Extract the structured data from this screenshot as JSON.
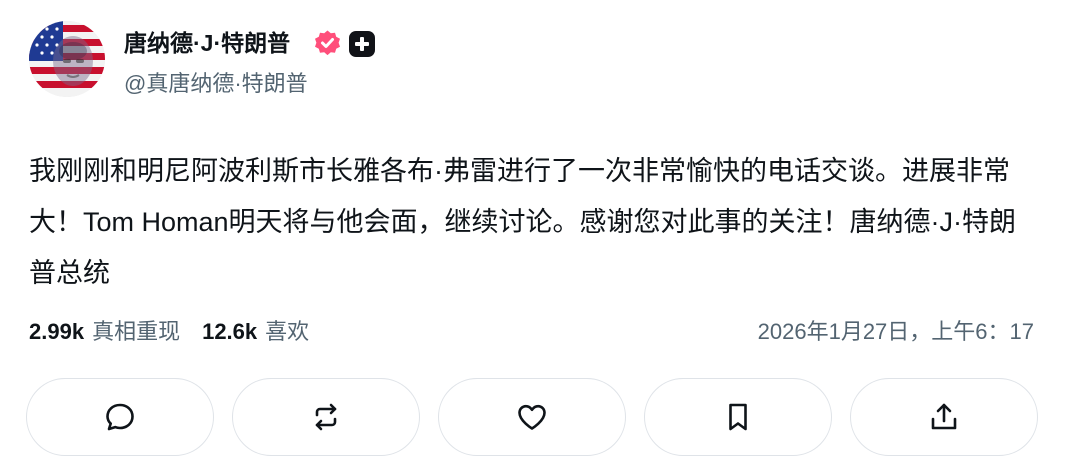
{
  "author": {
    "display_name": "唐纳德·J·特朗普",
    "handle": "@真唐纳德·特朗普",
    "verified_badge_color": "#ff4f7b",
    "subscriber_badge_color": "#111318"
  },
  "post": {
    "text": "我刚刚和明尼阿波利斯市长雅各布·弗雷进行了一次非常愉快的电话交谈。进展非常大！Tom Homan明天将与他会面，继续讨论。感谢您对此事的关注！唐纳德·J·特朗普总统",
    "timestamp": "2026年1月27日，上午6：17"
  },
  "stats": {
    "retruths": {
      "count": "2.99k",
      "label": "真相重现"
    },
    "likes": {
      "count": "12.6k",
      "label": "喜欢"
    }
  },
  "actions": [
    {
      "name": "reply",
      "icon": "comment-icon"
    },
    {
      "name": "retruth",
      "icon": "repost-icon"
    },
    {
      "name": "like",
      "icon": "heart-icon"
    },
    {
      "name": "bookmark",
      "icon": "bookmark-icon"
    },
    {
      "name": "share",
      "icon": "share-icon"
    }
  ],
  "colors": {
    "primary_text": "#0f1419",
    "secondary_text": "#536471",
    "button_border": "#dfe3e8"
  }
}
